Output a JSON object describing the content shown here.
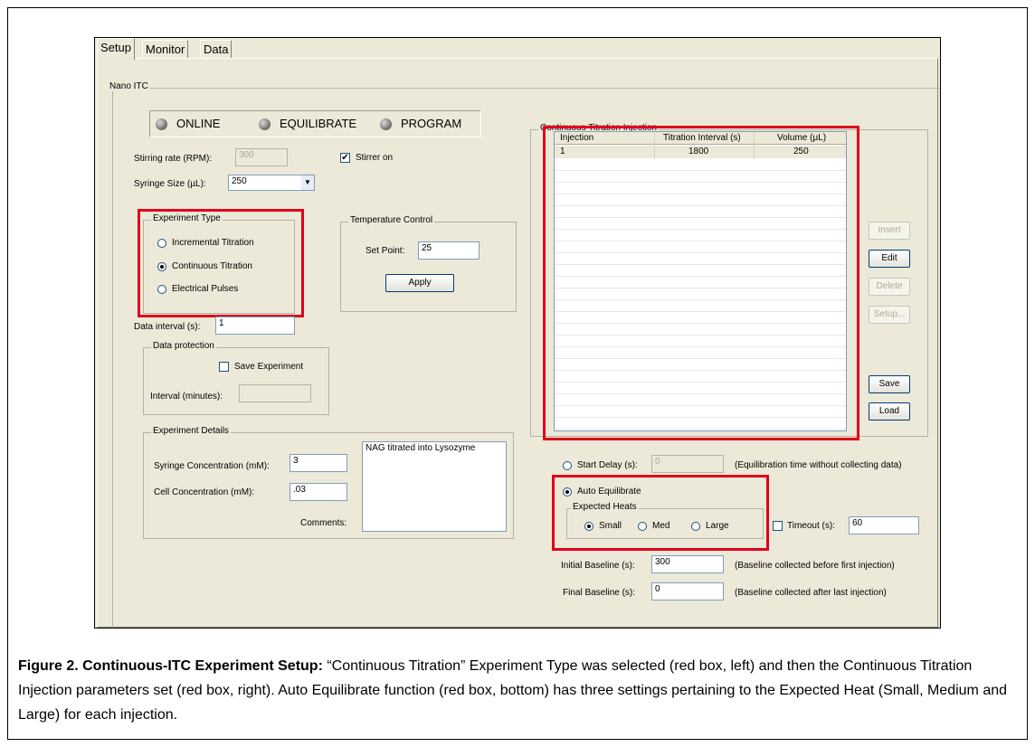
{
  "tabs": [
    "Setup",
    "Monitor",
    "Data"
  ],
  "nano_group_title": "Nano ITC",
  "status": {
    "online": "ONLINE",
    "equilibrate": "EQUILIBRATE",
    "program": "PROGRAM"
  },
  "stirring": {
    "label": "Stirring rate (RPM):",
    "value": "300"
  },
  "stirrer_on": {
    "label": "Stirrer on",
    "checked": "✔"
  },
  "syringe_size": {
    "label": "Syringe Size (µL):",
    "value": "250"
  },
  "experiment_type": {
    "title": "Experiment Type",
    "options": [
      "Incremental Titration",
      "Continuous Titration",
      "Electrical Pulses"
    ]
  },
  "temperature": {
    "title": "Temperature Control",
    "setpoint_label": "Set Point:",
    "setpoint_value": "25",
    "apply_label": "Apply"
  },
  "data_interval": {
    "label": "Data interval (s):",
    "value": "1"
  },
  "data_protection": {
    "title": "Data protection",
    "save_label": "Save Experiment",
    "interval_label": "Interval (minutes):"
  },
  "experiment_details": {
    "title": "Experiment Details",
    "syringe_label": "Syringe Concentration (mM):",
    "syringe_value": "3",
    "cell_label": "Cell Concentration (mM):",
    "cell_value": ".03",
    "comments_label": "Comments:",
    "comments_value": "NAG titrated into Lysozyme"
  },
  "injection": {
    "title": "Continuous Titration Injection",
    "columns": [
      "Injection",
      "Titration Interval (s)",
      "Volume (µL)"
    ],
    "rows": [
      [
        "1",
        "1800",
        "250"
      ]
    ]
  },
  "side_buttons": [
    "Insert",
    "Edit",
    "Delete",
    "Setup...",
    "Save",
    "Load"
  ],
  "start_delay": {
    "label": "Start Delay (s):",
    "value": "0",
    "note": "(Equilibration time without collecting data)"
  },
  "auto_equilibrate": {
    "label": "Auto Equilibrate",
    "heats_title": "Expected Heats",
    "options": [
      "Small",
      "Med",
      "Large"
    ]
  },
  "timeout": {
    "label": "Timeout (s):",
    "value": "60"
  },
  "initial_baseline": {
    "label": "Initial Baseline (s):",
    "value": "300",
    "note": "(Baseline collected before first injection)"
  },
  "final_baseline": {
    "label": "Final Baseline (s):",
    "value": "0",
    "note": "(Baseline collected after last injection)"
  },
  "caption": {
    "bold": "Figure 2.  Continuous-ITC Experiment Setup:",
    "text": " “Continuous Titration” Experiment Type was selected (red box, left) and then the Continuous Titration Injection parameters set (red box, right).  Auto Equilibrate function (red box, bottom) has three settings pertaining to the Expected Heat (Small, Medium and Large) for each injection."
  },
  "colors": {
    "highlight": "#e0001b",
    "window_bg": "#ece9d8",
    "selected_row": "#ece9d8"
  }
}
